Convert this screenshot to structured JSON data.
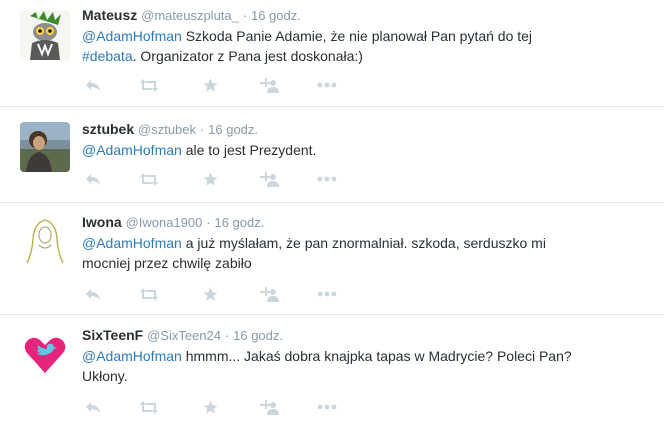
{
  "tweets": [
    {
      "fullname": "Mateusz",
      "username": "@mateuszpluta_",
      "separator": "·",
      "time": "16 godz.",
      "mention": "@AdamHofman",
      "text_after_mention": " Szkoda Panie Adamie, że nie planował Pan pytań do tej",
      "hashtag": "#debata",
      "text_after_hashtag": ". Organizator z Pana jest doskonała:)",
      "avatar_icon": "cartoon-lemur-avatar"
    },
    {
      "fullname": "sztubek",
      "username": "@sztubek",
      "separator": "·",
      "time": "16 godz.",
      "mention": "@AdamHofman",
      "text_after_mention": " ale to jest Prezydent.",
      "avatar_icon": "photo-person-avatar"
    },
    {
      "fullname": "Iwona",
      "username": "@Iwona1900",
      "separator": "·",
      "time": "16 godz.",
      "mention": "@AdamHofman",
      "text_after_mention": " a już myślałam, że pan znormalniał. szkoda, serduszko mi",
      "line2": "mocniej przez chwilę zabiło",
      "avatar_icon": "madonna-sketch-avatar"
    },
    {
      "fullname": "SixTeenF",
      "username": "@SixTeen24",
      "separator": "·",
      "time": "16 godz.",
      "mention": "@AdamHofman",
      "text_after_mention": " hmmm... Jakaś dobra knajpka tapas w Madrycie? Poleci Pan?",
      "line2": "Ukłony.",
      "avatar_icon": "twitter-heart-avatar"
    }
  ],
  "action_icons": [
    "reply-icon",
    "retweet-icon",
    "favorite-icon",
    "follow-icon",
    "more-icon"
  ],
  "colors": {
    "link": "#2b7bb9",
    "meta": "#8899a6",
    "action": "#ccd6dd",
    "border": "#e1e8ed",
    "text": "#292f33",
    "heart": "#e8237b"
  }
}
